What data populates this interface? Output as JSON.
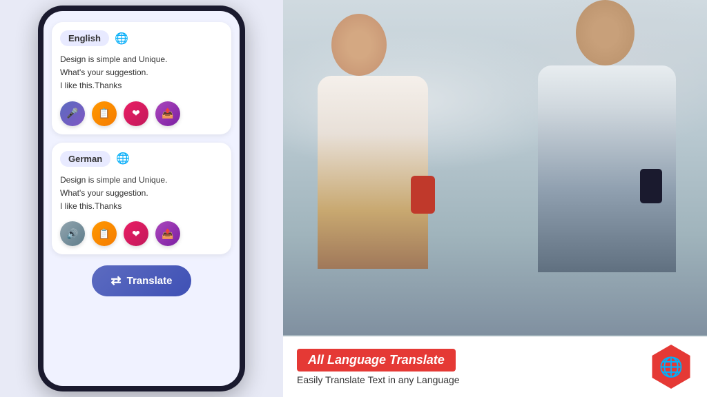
{
  "app": {
    "title": "All Language Translate"
  },
  "phone": {
    "source_lang": "English",
    "target_lang": "German",
    "source_text": "Design is simple and Unique.\nWhat's your suggestion.\nI like this.Thanks",
    "target_text": "Design is simple and Unique.\nWhat's your suggestion.\nI like this.Thanks",
    "translate_button_label": "Translate",
    "globe_icon": "🌐",
    "mic_icon": "🎤",
    "copy_icon": "📋",
    "heart_icon": "❤",
    "share_icon": "📤",
    "speaker_icon": "🔊"
  },
  "banner": {
    "title": "All Language Translate",
    "subtitle": "Easily Translate Text in any  Language"
  },
  "icons": {
    "translate_icon": "⇄",
    "globe_hex_icon": "🌐"
  }
}
